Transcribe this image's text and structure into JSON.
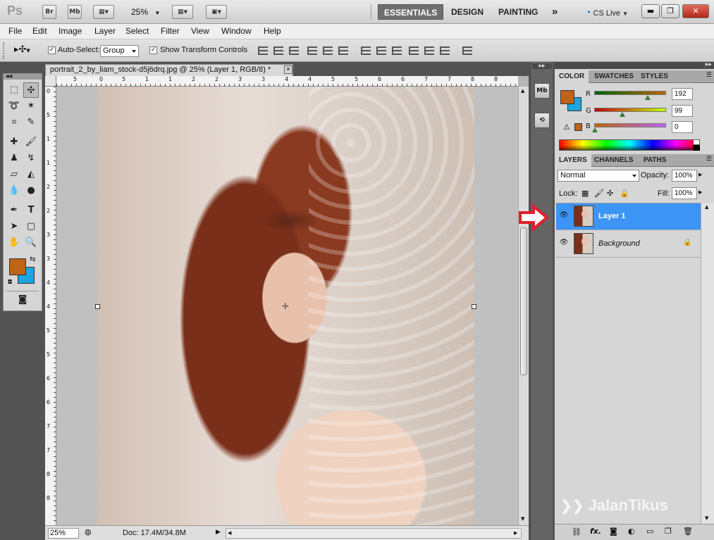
{
  "app": {
    "logo": "Ps",
    "bridge": "Br",
    "minibridge": "Mb",
    "zoom": "25%"
  },
  "workspaces": {
    "essentials": "ESSENTIALS",
    "design": "DESIGN",
    "painting": "PAINTING",
    "more": "»",
    "cslive": "CS Live"
  },
  "window_buttons": {
    "minimize": "▬",
    "restore": "❐",
    "close": "✕"
  },
  "menu": [
    "File",
    "Edit",
    "Image",
    "Layer",
    "Select",
    "Filter",
    "View",
    "Window",
    "Help"
  ],
  "options": {
    "auto_select_label": "Auto-Select:",
    "auto_select_value": "Group",
    "show_transform_label": "Show Transform Controls"
  },
  "document": {
    "tab_title": "portrait_2_by_liam_stock-d5j6drq.jpg @ 25% (Layer 1, RGB/8) *",
    "close": "✕",
    "status_zoom": "25%",
    "status_doc": "Doc: 17.4M/34.8M",
    "hruler_ticks": [
      "5",
      "0",
      "5",
      "1",
      "1",
      "2",
      "2",
      "3",
      "3",
      "4",
      "4",
      "5",
      "5",
      "6",
      "6",
      "7",
      "7",
      "8",
      "8"
    ],
    "vruler_ticks": [
      "0",
      "5",
      "1",
      "1",
      "2",
      "2",
      "3",
      "3",
      "4",
      "4",
      "5",
      "5",
      "6",
      "6",
      "7",
      "7",
      "8",
      "8"
    ]
  },
  "colors": {
    "foreground": "#c06317",
    "background": "#1ba6e0",
    "highlight": "#3c94f5",
    "arrow": "#e0202a"
  },
  "color_panel": {
    "tabs": [
      "COLOR",
      "SWATCHES",
      "STYLES"
    ],
    "r_label": "R",
    "r_value": "192",
    "g_label": "G",
    "g_value": "99",
    "b_label": "B",
    "b_value": "0"
  },
  "layers_panel": {
    "tabs": [
      "LAYERS",
      "CHANNELS",
      "PATHS"
    ],
    "blend_mode": "Normal",
    "opacity_label": "Opacity:",
    "opacity_value": "100%",
    "lock_label": "Lock:",
    "fill_label": "Fill:",
    "fill_value": "100%",
    "layers": [
      {
        "name": "Layer 1",
        "selected": true
      },
      {
        "name": "Background",
        "selected": false,
        "locked": true
      }
    ]
  },
  "watermark": "JalanTikus"
}
